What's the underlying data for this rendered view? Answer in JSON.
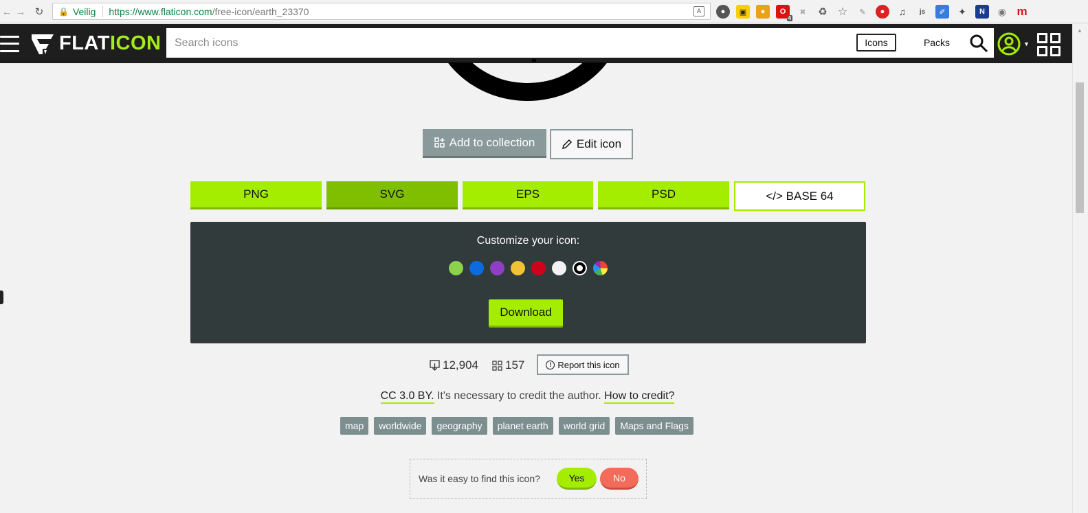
{
  "browser": {
    "security_label": "Veilig",
    "url_host": "https://www.flaticon.com",
    "url_path": "/free-icon/earth_23370",
    "extension_badge": "4"
  },
  "header": {
    "logo_flat": "FLAT",
    "logo_icon": "ICON",
    "search_placeholder": "Search icons",
    "tab_icons": "Icons",
    "tab_packs": "Packs"
  },
  "actions": {
    "add_to_collection": "Add to collection",
    "edit_icon": "Edit icon"
  },
  "formats": [
    {
      "label": "PNG"
    },
    {
      "label": "SVG"
    },
    {
      "label": "EPS"
    },
    {
      "label": "PSD"
    },
    {
      "label": "</> BASE 64"
    }
  ],
  "customize": {
    "title": "Customize your icon:",
    "colors": [
      "#8cd24a",
      "#0a6cdf",
      "#8e3fc4",
      "#f1c232",
      "#d0021b",
      "#f2f2f2",
      "#000000",
      "multicolor"
    ],
    "download_label": "Download"
  },
  "stats": {
    "downloads": "12,904",
    "collections": "157",
    "report_label": "Report this icon"
  },
  "license": {
    "name": "CC 3.0 BY.",
    "text": " It's necessary to credit the author. ",
    "how_to": "How to credit?"
  },
  "tags": [
    "map",
    "worldwide",
    "geography",
    "planet earth",
    "world grid",
    "Maps and Flags"
  ],
  "feedback": {
    "question": "Was it easy to find this icon?",
    "yes": "Yes",
    "no": "No"
  },
  "colors": {
    "brand_green": "#a4ec00",
    "panel_bg": "#323b3c",
    "header_bg": "#1e1e1e"
  }
}
